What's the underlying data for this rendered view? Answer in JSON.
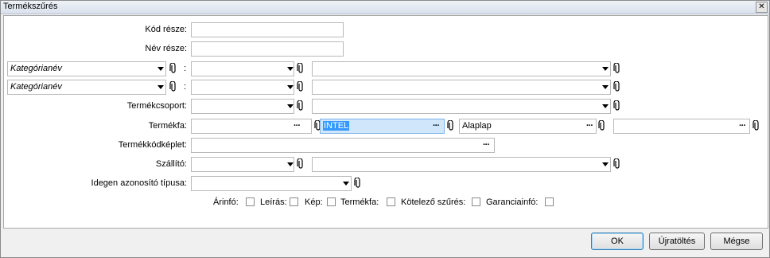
{
  "window": {
    "title": "Termékszűrés",
    "close_glyph": "✕"
  },
  "form": {
    "kod_label": "Kód része:",
    "kod_value": "",
    "nev_label": "Név része:",
    "nev_value": "",
    "cat1_name": "Kategórianév",
    "cat2_name": "Kategórianév",
    "colon": ":",
    "termekcsoport_label": "Termékcsoport:",
    "termekfa_label": "Termékfa:",
    "termekfa_values": [
      "",
      "INTEL",
      "Alaplap",
      ""
    ],
    "termekkod_label": "Termékkódképlet:",
    "szallito_label": "Szállító:",
    "idegen_label": "Idegen azonosító típusa:",
    "ellipsis": "···"
  },
  "checkboxes": [
    {
      "label": "Árinfó:",
      "checked": false
    },
    {
      "label": "Leírás:",
      "checked": false
    },
    {
      "label": "Kép:",
      "checked": false
    },
    {
      "label": "Termékfa:",
      "checked": false
    },
    {
      "label": "Kötelező szűrés:",
      "checked": false
    },
    {
      "label": "Garanciainfó:",
      "checked": false
    }
  ],
  "buttons": {
    "ok": "OK",
    "reload": "Újratöltés",
    "cancel": "Mégse"
  },
  "colors": {
    "selection_bg": "#3399ff",
    "selected_field_bg": "#cfe6fb"
  }
}
